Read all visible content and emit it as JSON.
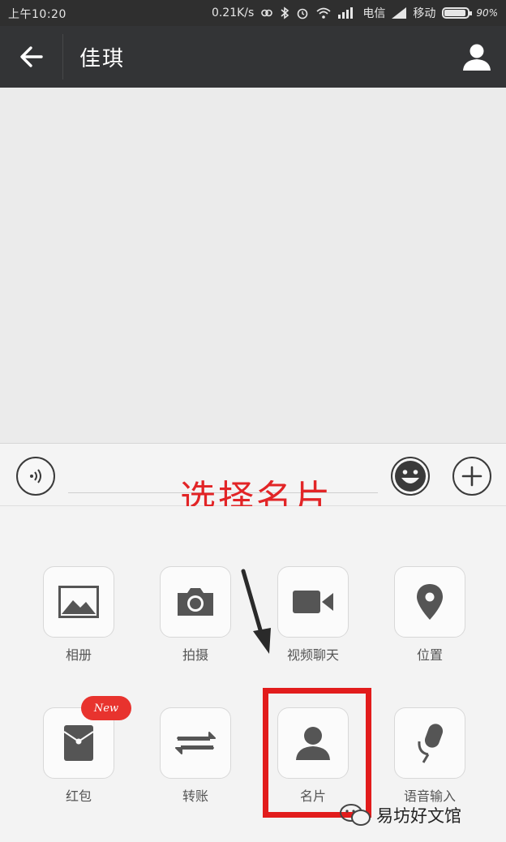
{
  "status_bar": {
    "time": "上午10:20",
    "net_speed": "0.21K/s",
    "carrier1": "电信",
    "carrier2": "移动",
    "battery_label": "90%"
  },
  "header": {
    "title": "佳琪",
    "back_icon": "arrow-left-icon",
    "profile_icon": "person-icon"
  },
  "annotation": "选择名片",
  "panel": {
    "items": [
      {
        "label": "相册",
        "icon": "image-icon"
      },
      {
        "label": "拍摄",
        "icon": "camera-icon"
      },
      {
        "label": "视频聊天",
        "icon": "video-camera-icon"
      },
      {
        "label": "位置",
        "icon": "location-pin-icon"
      },
      {
        "label": "红包",
        "icon": "red-packet-icon"
      },
      {
        "label": "转账",
        "icon": "transfer-icon"
      },
      {
        "label": "名片",
        "icon": "person-card-icon"
      },
      {
        "label": "语音输入",
        "icon": "microphone-icon"
      }
    ],
    "new_badge": "New"
  },
  "watermark": "易坊好文馆",
  "colors": {
    "header_bg": "#333436",
    "annotation": "#e22426",
    "highlight": "#e21c1c",
    "badge": "#e8332e"
  }
}
